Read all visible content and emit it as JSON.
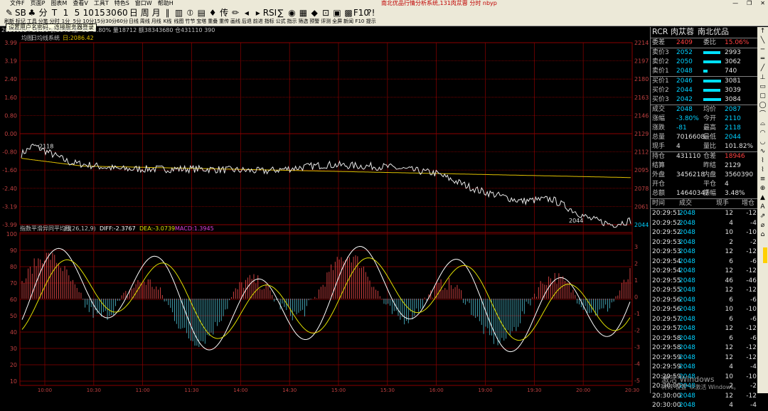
{
  "menu": [
    "文件F",
    "页面P",
    "图表M",
    "查看V",
    "工具T",
    "特色S",
    "窗口W",
    "帮助H"
  ],
  "app_title": "南北优品行情分析系统,131肉苁蓉 分时 nbyp",
  "window_buttons": [
    "—",
    "❐",
    "✕"
  ],
  "toolbar": [
    {
      "g": "✎",
      "l": "刷新"
    },
    {
      "g": "SB",
      "l": "标记"
    },
    {
      "g": "♣",
      "l": "工具"
    },
    {
      "g": "分",
      "l": "分笔"
    },
    {
      "g": "T",
      "l": "分时"
    },
    {
      "g": "1",
      "l": "1分"
    },
    {
      "g": "5",
      "l": "5分"
    },
    {
      "g": "10",
      "l": "10分"
    },
    {
      "g": "15",
      "l": "15分"
    },
    {
      "g": "30",
      "l": "30分"
    },
    {
      "g": "60",
      "l": "60分"
    },
    {
      "g": "日",
      "l": "日线"
    },
    {
      "g": "周",
      "l": "周线"
    },
    {
      "g": "月",
      "l": "月线"
    },
    {
      "g": "∥",
      "l": "K线"
    },
    {
      "g": "▥",
      "l": "线图"
    },
    {
      "g": "⦶",
      "l": "竹节"
    },
    {
      "g": "▤",
      "l": "宝塔"
    },
    {
      "g": "♦",
      "l": "重叠"
    },
    {
      "g": "传",
      "l": "重传"
    },
    {
      "g": "✏",
      "l": "画线"
    },
    {
      "g": "◂",
      "l": "后退"
    },
    {
      "g": "▸",
      "l": "前进"
    },
    {
      "g": "RSI",
      "l": "指标"
    },
    {
      "g": "∑",
      "l": "公式"
    },
    {
      "g": "◉",
      "l": "指示"
    },
    {
      "g": "▦",
      "l": "筛选"
    },
    {
      "g": "◆",
      "l": "预警"
    },
    {
      "g": "⊡",
      "l": "评测"
    },
    {
      "g": "▣",
      "l": "全屏"
    },
    {
      "g": "▩",
      "l": "新闻"
    },
    {
      "g": "F10",
      "l": "F10"
    },
    {
      "g": "?!",
      "l": "提示"
    }
  ],
  "tooltip": "设置用户名密码，连接服务器登录",
  "header_info": "20200314 20:30 价2048 涨 -81 -3.80% 量18712 额38343680 仓431110 390",
  "price_pane": {
    "label": "均图",
    "avg_label": "日均线系统",
    "avg_value": "日:2086.42",
    "left_ticks": [
      "3.99",
      "3.19",
      "2.40",
      "1.60",
      "0.80",
      "0.00",
      "-0.80",
      "-1.60",
      "-2.40",
      "-3.19",
      "-3.99"
    ],
    "right_ticks": [
      "2214",
      "2197",
      "2180",
      "2163",
      "2146",
      "2129",
      "2112",
      "2095",
      "2078",
      "2061",
      "2044"
    ],
    "high_mark": "2118",
    "low_mark": "2044"
  },
  "macd_pane": {
    "title": "指数平滑异同平均线",
    "params": "日(26,12,9)",
    "diff": "DIFF:-2.3767",
    "dea": "DEA:-3.0739",
    "macd": "MACD:1.3945",
    "left_ticks": [
      "100",
      "90",
      "80",
      "70",
      "60",
      "50",
      "40",
      "30",
      "20",
      "10"
    ],
    "right_ticks": [
      "3",
      "2",
      "1",
      "0",
      "-1",
      "-2",
      "-3",
      "-4",
      "-5"
    ]
  },
  "time_axis": [
    "10:00",
    "10:30",
    "11:00",
    "11:30",
    "14:00",
    "14:30",
    "15:00",
    "15:30",
    "16:00",
    "19:00",
    "19:30",
    "20:00",
    "20:30"
  ],
  "colors": {
    "grid": "#8b0000",
    "price": "#e8e8e8",
    "avg": "#e0c000",
    "pos": "#d04040",
    "neg": "#40a0b0",
    "diff": "#ffffff",
    "dea": "#e0e000",
    "macd": "#e040e0",
    "diffLabel": "#ffffff",
    "deaLabel": "#e0e000",
    "macdLabel": "#e040e0"
  },
  "quote": {
    "code": "RCR",
    "name": "肉苁蓉",
    "brand": "南北优品",
    "weicha_label": "委差",
    "weicha": "2409",
    "weibi_label": "委比",
    "weibi": "15.06%",
    "asks": [
      {
        "label": "卖价3",
        "price": "2052",
        "vol": "2993",
        "bar": 0.92
      },
      {
        "label": "卖价2",
        "price": "2050",
        "vol": "3062",
        "bar": 0.95
      },
      {
        "label": "卖价1",
        "price": "2048",
        "vol": "740",
        "bar": 0.23
      }
    ],
    "bids": [
      {
        "label": "买价1",
        "price": "2046",
        "vol": "3081",
        "bar": 0.95
      },
      {
        "label": "买价2",
        "price": "2044",
        "vol": "3039",
        "bar": 0.94
      },
      {
        "label": "买价3",
        "price": "2042",
        "vol": "3084",
        "bar": 0.95
      }
    ],
    "stats": [
      [
        {
          "k": "成交",
          "v": "2048",
          "c": "#00d0ff"
        },
        {
          "k": "均价",
          "v": "2087",
          "c": "#00d0ff"
        }
      ],
      [
        {
          "k": "涨幅",
          "v": "-3.80%",
          "c": "#00d0ff"
        },
        {
          "k": "今开",
          "v": "2110",
          "c": "#00d0ff"
        }
      ],
      [
        {
          "k": "涨跌",
          "v": "-81",
          "c": "#00d0ff"
        },
        {
          "k": "最高",
          "v": "2118",
          "c": "#00d0ff"
        }
      ],
      [
        {
          "k": "总量",
          "v": "7016608",
          "c": "#e0e0e0"
        },
        {
          "k": "最低",
          "v": "2044",
          "c": "#00d0ff"
        }
      ],
      [
        {
          "k": "现手",
          "v": "4",
          "c": "#e0e0e0"
        },
        {
          "k": "量比",
          "v": "101.82%",
          "c": "#e0e0e0"
        }
      ]
    ],
    "stats2": [
      [
        {
          "k": "持仓",
          "v": "431110",
          "c": "#e0e0e0"
        },
        {
          "k": "仓差",
          "v": "18946",
          "c": "#ff4040"
        }
      ],
      [
        {
          "k": "结算",
          "v": "",
          "c": "#e0e0e0"
        },
        {
          "k": "昨结",
          "v": "2129",
          "c": "#e0e0e0"
        }
      ],
      [
        {
          "k": "外盘",
          "v": "3456218",
          "c": "#e0e0e0"
        },
        {
          "k": "内盘",
          "v": "3560390",
          "c": "#e0e0e0"
        }
      ],
      [
        {
          "k": "开仓",
          "v": "",
          "c": "#e0e0e0"
        },
        {
          "k": "平仓",
          "v": "4",
          "c": "#e0e0e0"
        }
      ],
      [
        {
          "k": "总额",
          "v": "14640347",
          "c": "#e0e0e0"
        },
        {
          "k": "振幅",
          "v": "3.48%",
          "c": "#e0e0e0"
        }
      ]
    ]
  },
  "ticks_header": [
    "时间",
    "成交",
    "现手",
    "增仓"
  ],
  "ticks": [
    [
      "20:29:51",
      "2048",
      "12",
      "-12"
    ],
    [
      "20:29:52",
      "2048",
      "4",
      "-4"
    ],
    [
      "20:29:52",
      "2048",
      "10",
      "-10"
    ],
    [
      "20:29:53",
      "2048",
      "2",
      "-2"
    ],
    [
      "20:29:53",
      "2048",
      "12",
      "-12"
    ],
    [
      "20:29:54",
      "2048",
      "6",
      "-6"
    ],
    [
      "20:29:54",
      "2048",
      "12",
      "-12"
    ],
    [
      "20:29:55",
      "2048",
      "46",
      "-46"
    ],
    [
      "20:29:55",
      "2048",
      "12",
      "-12"
    ],
    [
      "20:29:56",
      "2048",
      "6",
      "-6"
    ],
    [
      "20:29:56",
      "2048",
      "10",
      "-10"
    ],
    [
      "20:29:57",
      "2048",
      "6",
      "-6"
    ],
    [
      "20:29:57",
      "2048",
      "12",
      "-12"
    ],
    [
      "20:29:58",
      "2048",
      "6",
      "-6"
    ],
    [
      "20:29:58",
      "2048",
      "12",
      "-12"
    ],
    [
      "20:29:59",
      "2048",
      "12",
      "-12"
    ],
    [
      "20:29:59",
      "2048",
      "4",
      "-4"
    ],
    [
      "20:29:59",
      "2048",
      "10",
      "-10"
    ],
    [
      "20:30:00",
      "2048",
      "2",
      "-2"
    ],
    [
      "20:30:00",
      "2048",
      "12",
      "-12"
    ],
    [
      "20:30:00",
      "2048",
      "4",
      "-4"
    ]
  ],
  "side_tools": [
    "↑",
    "╲",
    "─",
    "═",
    "╱",
    "⊥",
    "▭",
    "▢",
    "◯",
    "⌒",
    "⌓",
    "◠",
    "◡",
    "∿",
    "⌇",
    "⌇",
    "≡",
    "⊕",
    "▲",
    "A",
    "⇗",
    "⌀",
    "⌂"
  ],
  "watermark": "激活 Windows",
  "watermark_sub": "转到\"设置\"以激活 Windows。"
}
